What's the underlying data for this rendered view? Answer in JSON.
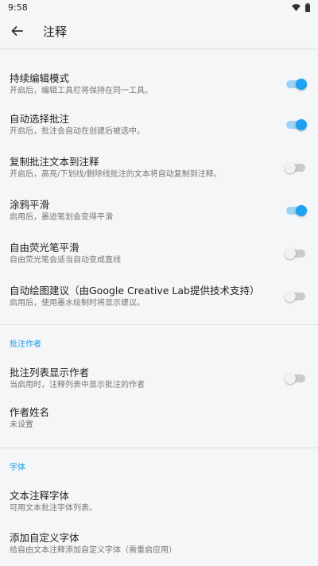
{
  "status": {
    "time": "9:58"
  },
  "appbar": {
    "title": "注释"
  },
  "colors": {
    "accent": "#1ea1f2",
    "section_header": "#1a9be6"
  },
  "general": [
    {
      "title": "持续编辑模式",
      "subtitle": "开启后，编辑工具栏将保持在同一工具。",
      "toggle": true
    },
    {
      "title": "自动选择批注",
      "subtitle": "开启后，批注会自动在创建后被选中。",
      "toggle": true
    },
    {
      "title": "复制批注文本到注释",
      "subtitle": "开启后，高亮/下划线/删除线批注的文本将自动复制到注释。",
      "toggle": false
    },
    {
      "title": "涂鸦平滑",
      "subtitle": "启用后，墨迹笔划会变得平滑",
      "toggle": true
    },
    {
      "title": "自由荧光笔平滑",
      "subtitle": "自由荧光笔会适当自动变成直线",
      "toggle": false
    },
    {
      "title": "自动绘图建议（由Google Creative Lab提供技术支持）",
      "subtitle": "启用后，使用墨水绘制时将显示建议。",
      "toggle": false
    }
  ],
  "author_section": {
    "header": "批注作者",
    "items": [
      {
        "title": "批注列表显示作者",
        "subtitle": "当启用时，注释列表中显示批注的作者"
      },
      {
        "title": "作者姓名",
        "subtitle": "未设置"
      }
    ],
    "show_author_toggle": false
  },
  "font_section": {
    "header": "字体",
    "items": [
      {
        "title": "文本注释字体",
        "subtitle": "可用文本批注字体列表。"
      },
      {
        "title": "添加自定义字体",
        "subtitle": "给自由文本注释添加自定义字体（需重启应用）"
      }
    ]
  }
}
